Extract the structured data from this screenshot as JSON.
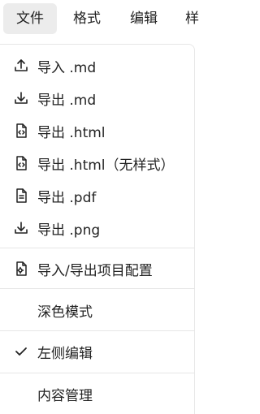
{
  "menubar": {
    "items": [
      {
        "label": "文件"
      },
      {
        "label": "格式"
      },
      {
        "label": "编辑"
      },
      {
        "label": "样"
      }
    ]
  },
  "file_menu": {
    "items": [
      {
        "label": "导入 .md",
        "icon": "upload-icon"
      },
      {
        "label": "导出 .md",
        "icon": "download-icon"
      },
      {
        "label": "导出 .html",
        "icon": "code-file-icon"
      },
      {
        "label": "导出 .html（无样式）",
        "icon": "code-file-icon"
      },
      {
        "label": "导出 .pdf",
        "icon": "document-icon"
      },
      {
        "label": "导出 .png",
        "icon": "download-icon"
      },
      {
        "label": "导入/导出项目配置",
        "icon": "settings-file-icon"
      },
      {
        "label": "深色模式"
      },
      {
        "label": "左侧编辑",
        "icon": "check-icon",
        "checked": true
      },
      {
        "label": "内容管理"
      }
    ]
  },
  "colors": {
    "text": "#222222",
    "active_bg": "#ececec",
    "divider": "#e6e6e6"
  }
}
